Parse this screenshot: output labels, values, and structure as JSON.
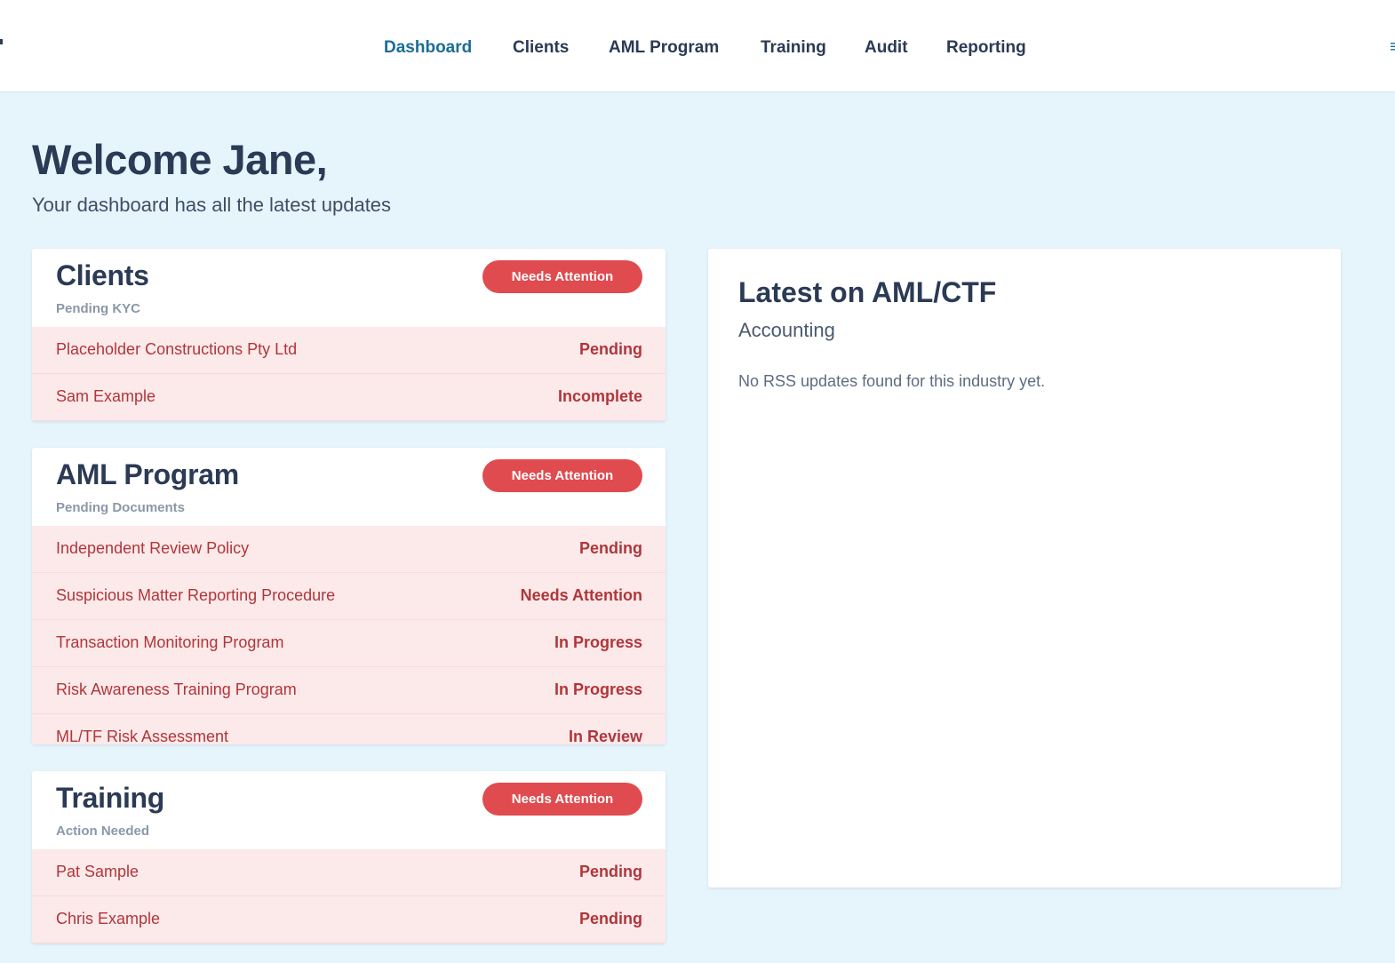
{
  "nav": {
    "items": [
      {
        "label": "Dashboard",
        "active": true
      },
      {
        "label": "Clients",
        "active": false
      },
      {
        "label": "AML Program",
        "active": false
      },
      {
        "label": "Training",
        "active": false
      },
      {
        "label": "Audit",
        "active": false
      },
      {
        "label": "Reporting",
        "active": false
      }
    ]
  },
  "header": {
    "welcome": "Welcome Jane,",
    "subtitle": "Your dashboard has all the latest updates"
  },
  "cards": [
    {
      "title": "Clients",
      "subtitle": "Pending KYC",
      "badge": "Needs Attention",
      "rows": [
        {
          "label": "Placeholder Constructions Pty Ltd",
          "status": "Pending"
        },
        {
          "label": "Sam Example",
          "status": "Incomplete"
        }
      ]
    },
    {
      "title": "AML Program",
      "subtitle": "Pending Documents",
      "badge": "Needs Attention",
      "rows": [
        {
          "label": "Independent Review Policy",
          "status": "Pending"
        },
        {
          "label": "Suspicious Matter Reporting Procedure",
          "status": "Needs Attention"
        },
        {
          "label": "Transaction Monitoring Program",
          "status": "In Progress"
        },
        {
          "label": "Risk Awareness Training Program",
          "status": "In Progress"
        },
        {
          "label": "ML/TF Risk Assessment",
          "status": "In Review"
        }
      ]
    },
    {
      "title": "Training",
      "subtitle": "Action Needed",
      "badge": "Needs Attention",
      "rows": [
        {
          "label": "Pat Sample",
          "status": "Pending"
        },
        {
          "label": "Chris Example",
          "status": "Pending"
        }
      ]
    }
  ],
  "news": {
    "title": "Latest on AML/CTF",
    "industry": "Accounting",
    "empty_message": "No RSS updates found for this industry yet."
  },
  "colors": {
    "background": "#e6f5fb",
    "accent": "#1a6d96",
    "alert": "#e04b4f",
    "alert_text": "#b0363a",
    "alert_bg": "#fce9ea"
  }
}
